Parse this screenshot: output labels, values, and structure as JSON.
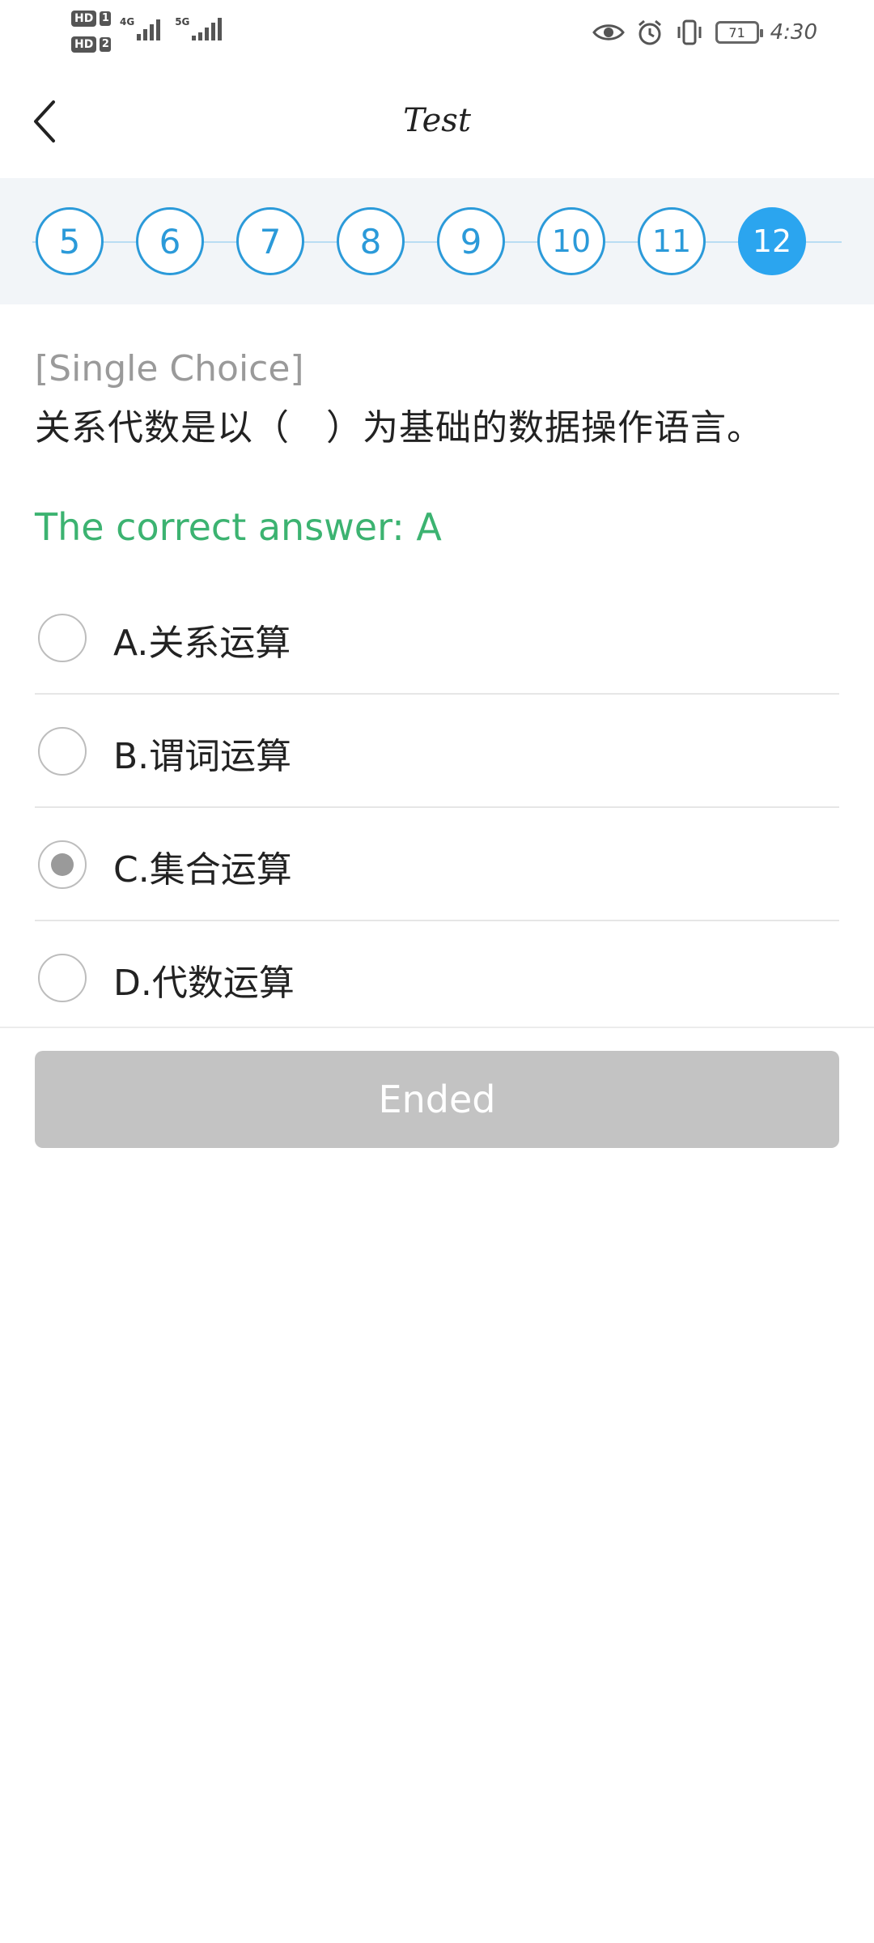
{
  "status_bar": {
    "sim1": {
      "badge": "HD",
      "num": "1"
    },
    "sim2": {
      "badge": "HD",
      "num": "2"
    },
    "net1": "4G",
    "net2": "5G",
    "battery": "71",
    "time": "4:30"
  },
  "header": {
    "title": "Test"
  },
  "question_nav": [
    {
      "label": "5",
      "active": false
    },
    {
      "label": "6",
      "active": false
    },
    {
      "label": "7",
      "active": false
    },
    {
      "label": "8",
      "active": false
    },
    {
      "label": "9",
      "active": false
    },
    {
      "label": "10",
      "active": false
    },
    {
      "label": "11",
      "active": false
    },
    {
      "label": "12",
      "active": true
    }
  ],
  "question": {
    "type": "[Single Choice]",
    "text": "关系代数是以（　）为基础的数据操作语言。",
    "correct_answer": "The correct answer:   A"
  },
  "options": [
    {
      "label": "A.关系运算",
      "selected": false
    },
    {
      "label": "B.谓词运算",
      "selected": false
    },
    {
      "label": "C.集合运算",
      "selected": true
    },
    {
      "label": "D.代数运算",
      "selected": false
    }
  ],
  "footer": {
    "button_label": "Ended"
  },
  "colors": {
    "accent": "#2ba5ef",
    "correct": "#3cb371",
    "disabled_button": "#c3c3c3"
  }
}
